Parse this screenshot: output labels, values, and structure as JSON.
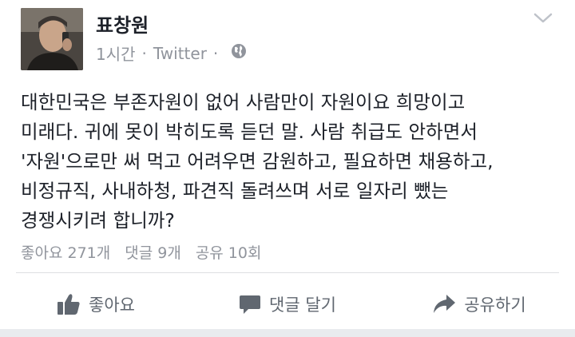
{
  "post": {
    "author": "표창원",
    "time": "1시간",
    "separator": "·",
    "source": "Twitter",
    "privacy_icon": "globe-icon",
    "menu_icon": "chevron-down-icon",
    "text_lines": [
      "대한민국은 부존자원이 없어 사람만이 자원이요 희망이고",
      "미래다. 귀에 못이 박히도록 듣던 말. 사람 취급도 안하면서",
      "'자원'으로만 써 먹고 어려우면 감원하고, 필요하면 채용하고,",
      "비정규직, 사내하청, 파견직 돌려쓰며 서로 일자리 뺐는",
      "경쟁시키려 합니까?"
    ]
  },
  "stats": {
    "likes": "좋아요 271개",
    "comments": "댓글 9개",
    "shares": "공유 10회"
  },
  "actions": {
    "like_label": "좋아요",
    "comment_label": "댓글 달기",
    "share_label": "공유하기"
  },
  "colors": {
    "text": "#1d2129",
    "muted": "#90949c",
    "action": "#606770",
    "divider": "#dddfe2"
  }
}
